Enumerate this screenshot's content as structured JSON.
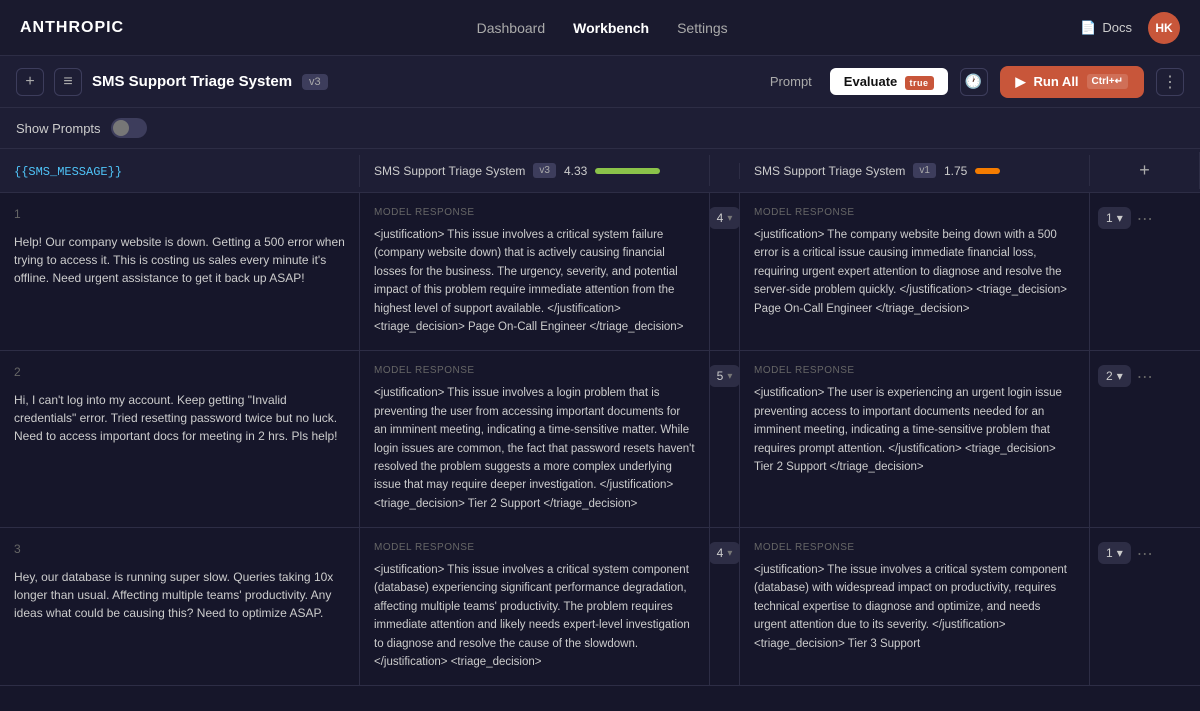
{
  "nav": {
    "logo": "ANTHROPIC",
    "links": [
      {
        "label": "Dashboard",
        "active": false
      },
      {
        "label": "Workbench",
        "active": true
      },
      {
        "label": "Settings",
        "active": false
      }
    ],
    "docs_label": "Docs",
    "avatar_initials": "HK"
  },
  "toolbar": {
    "add_icon": "+",
    "list_icon": "≡",
    "project_title": "SMS Support Triage System",
    "version": "v3",
    "tabs": [
      {
        "label": "Prompt",
        "active": false
      },
      {
        "label": "Evaluate",
        "active": true,
        "beta": true
      }
    ],
    "history_icon": "🕐",
    "run_all_label": "Run All",
    "run_all_shortcut": "Ctrl+↵",
    "more_icon": "⋮"
  },
  "show_prompts": {
    "label": "Show Prompts"
  },
  "columns": [
    {
      "label": "{{SMS_MESSAGE}}",
      "is_template": true
    },
    {
      "model_name": "SMS Support Triage System",
      "model_version": "v3",
      "score": "4.33",
      "score_bar_width": 65
    },
    {
      "model_name": "SMS Support Triage System",
      "model_version": "v1",
      "score": "1.75",
      "score_bar_width": 25
    }
  ],
  "rows": [
    {
      "number": "1",
      "message": "Help! Our company website is down. Getting a 500 error when trying to access it. This is costing us sales every minute it's offline. Need urgent assistance to get it back up ASAP!",
      "response_v3": "<justification>\nThis issue involves a critical system failure (company website down) that is actively causing financial losses for the business. The urgency, severity, and potential impact of this problem require immediate attention from the highest level of support available.\n</justification>\n\n<triage_decision>\nPage On-Call Engineer\n</triage_decision>",
      "score_v3": "4",
      "response_v1": "<justification>\nThe company website being down with a 500 error is a critical issue causing immediate financial loss, requiring urgent expert attention to diagnose and resolve the server-side problem quickly.\n</justification>\n\n<triage_decision>\nPage On-Call Engineer\n</triage_decision>",
      "score_v1": "1"
    },
    {
      "number": "2",
      "message": "Hi, I can't log into my account. Keep getting \"Invalid credentials\" error. Tried resetting password twice but no luck. Need to access important docs for meeting in 2 hrs. Pls help!",
      "response_v3": "<justification>\nThis issue involves a login problem that is preventing the user from accessing important documents for an imminent meeting, indicating a time-sensitive matter. While login issues are common, the fact that password resets haven't resolved the problem suggests a more complex underlying issue that may require deeper investigation.\n</justification>\n\n<triage_decision>\nTier 2 Support\n</triage_decision>",
      "score_v3": "5",
      "response_v1": "<justification>\nThe user is experiencing an urgent login issue preventing access to important documents needed for an imminent meeting, indicating a time-sensitive problem that requires prompt attention.\n</justification>\n\n<triage_decision>\nTier 2 Support\n</triage_decision>",
      "score_v1": "2"
    },
    {
      "number": "3",
      "message": "Hey, our database is running super slow. Queries taking 10x longer than usual. Affecting multiple teams' productivity. Any ideas what could be causing this? Need to optimize ASAP.",
      "response_v3": "<justification>\nThis issue involves a critical system component (database) experiencing significant performance degradation, affecting multiple teams' productivity. The problem requires immediate attention and likely needs expert-level investigation to diagnose and resolve the cause of the slowdown.\n</justification>\n\n<triage_decision>",
      "score_v3": "4",
      "response_v1": "<justification>\nThe issue involves a critical system component (database) with widespread impact on productivity, requires technical expertise to diagnose and optimize, and needs urgent attention due to its severity.\n</justification>\n\n<triage_decision>\nTier 3 Support",
      "score_v1": "1"
    }
  ]
}
